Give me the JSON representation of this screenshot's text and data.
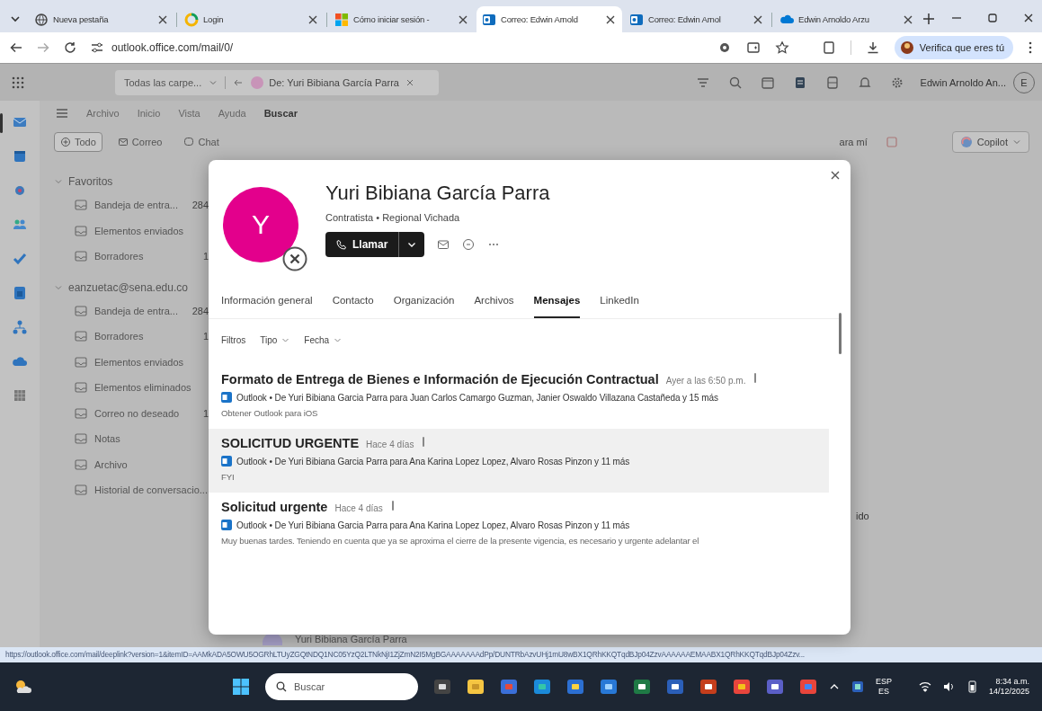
{
  "browser": {
    "tabs": [
      {
        "title": "Nueva pestaña",
        "selected": false
      },
      {
        "title": "Login",
        "selected": false
      },
      {
        "title": "Cómo iniciar sesión -",
        "selected": false
      },
      {
        "title": "Correo: Edwin Arnold",
        "selected": true
      },
      {
        "title": "Correo: Edwin Arnol",
        "selected": false
      },
      {
        "title": "Edwin Arnoldo Arzu",
        "selected": false
      }
    ],
    "address": "outlook.office.com/mail/0/",
    "profile_button": "Verifica que eres tú"
  },
  "outlook": {
    "search_scope": "Todas las carpe...",
    "search_chip": "De: Yuri Bibiana García Parra",
    "account_name": "Edwin Arnoldo An...",
    "account_initial": "E",
    "ribbon_tabs": [
      {
        "label": "Archivo",
        "selected": false
      },
      {
        "label": "Inicio",
        "selected": false
      },
      {
        "label": "Vista",
        "selected": false
      },
      {
        "label": "Ayuda",
        "selected": false
      },
      {
        "label": "Buscar",
        "selected": true
      }
    ],
    "filters": [
      {
        "label": "Todo",
        "selected": true
      },
      {
        "label": "Correo",
        "selected": false
      },
      {
        "label": "Chat",
        "selected": false
      }
    ],
    "toolbar_fragment": "ara mí",
    "copilot": "Copilot",
    "folders": [
      {
        "label": "Favoritos",
        "expanded": true,
        "children": [
          {
            "label": "Bandeja de entra...",
            "count": "284"
          },
          {
            "label": "Elementos enviados"
          },
          {
            "label": "Borradores",
            "count": "1"
          }
        ]
      },
      {
        "label": "eanzuetac@sena.edu.co",
        "expanded": true,
        "children": [
          {
            "label": "Bandeja de entra...",
            "count": "284"
          },
          {
            "label": "Borradores",
            "count": "1"
          },
          {
            "label": "Elementos enviados"
          },
          {
            "label": "Elementos eliminados"
          },
          {
            "label": "Correo no deseado",
            "count": "1"
          },
          {
            "label": "Notas"
          },
          {
            "label": "Archivo"
          },
          {
            "label": "Historial de conversacio..."
          }
        ]
      }
    ],
    "background_fragment": "ido",
    "background_sender": "Yuri Bibiana García Parra"
  },
  "contact_card": {
    "initial": "Y",
    "name": "Yuri Bibiana García Parra",
    "subtitle": "Contratista • Regional Vichada",
    "call_button": "Llamar",
    "tabs": [
      {
        "label": "Información general",
        "selected": false
      },
      {
        "label": "Contacto",
        "selected": false
      },
      {
        "label": "Organización",
        "selected": false
      },
      {
        "label": "Archivos",
        "selected": false
      },
      {
        "label": "Mensajes",
        "selected": true
      },
      {
        "label": "LinkedIn",
        "selected": false
      }
    ],
    "filters_label": "Filtros",
    "filters": [
      "Tipo",
      "Fecha"
    ],
    "messages": [
      {
        "subject": "Formato de Entrega de Bienes e Información de Ejecución Contractual",
        "time": "Ayer a las 6:50 p.m.",
        "has_attachment": true,
        "source": "Outlook",
        "participants": "• De Yuri Bibiana Garcia Parra para Juan Carlos Camargo Guzman, Janier Oswaldo Villazana Castañeda y 15 más",
        "preview": "Obtener Outlook para iOS",
        "selected": false
      },
      {
        "subject": "SOLICITUD URGENTE",
        "time": "Hace 4 días",
        "has_attachment": true,
        "source": "Outlook",
        "participants": "• De Yuri Bibiana Garcia Parra para Ana Karina Lopez Lopez, Alvaro Rosas Pinzon y 11 más",
        "preview": "FYI",
        "selected": true
      },
      {
        "subject": "Solicitud urgente",
        "time": "Hace 4 días",
        "has_attachment": true,
        "source": "Outlook",
        "participants": "• De Yuri Bibiana Garcia Parra para Ana Karina Lopez Lopez, Alvaro Rosas Pinzon y 11 más",
        "preview": "Muy buenas tardes. Teniendo en cuenta que ya se aproxima el cierre de la presente vigencia, es necesario y urgente adelantar el",
        "selected": false
      }
    ]
  },
  "status_url": "https://outlook.office.com/mail/deeplink?version=1&itemID=AAMkADA5OWU5OGRhLTUyZGQtNDQ1NC05YzQ2LTNkNjI1ZjZmN2I5MgBGAAAAAAAdPp/DUNTRbAzvUHj1mU8wBX1QRhKKQTqdBJp04ZzvAAAAAAEMAABX1QRhKKQTqdBJp04Zzv...",
  "taskbar": {
    "search_placeholder": "Buscar",
    "language": "ESP",
    "layout": "ES",
    "time": "8:34 a.m.",
    "date": "14/12/2025"
  }
}
